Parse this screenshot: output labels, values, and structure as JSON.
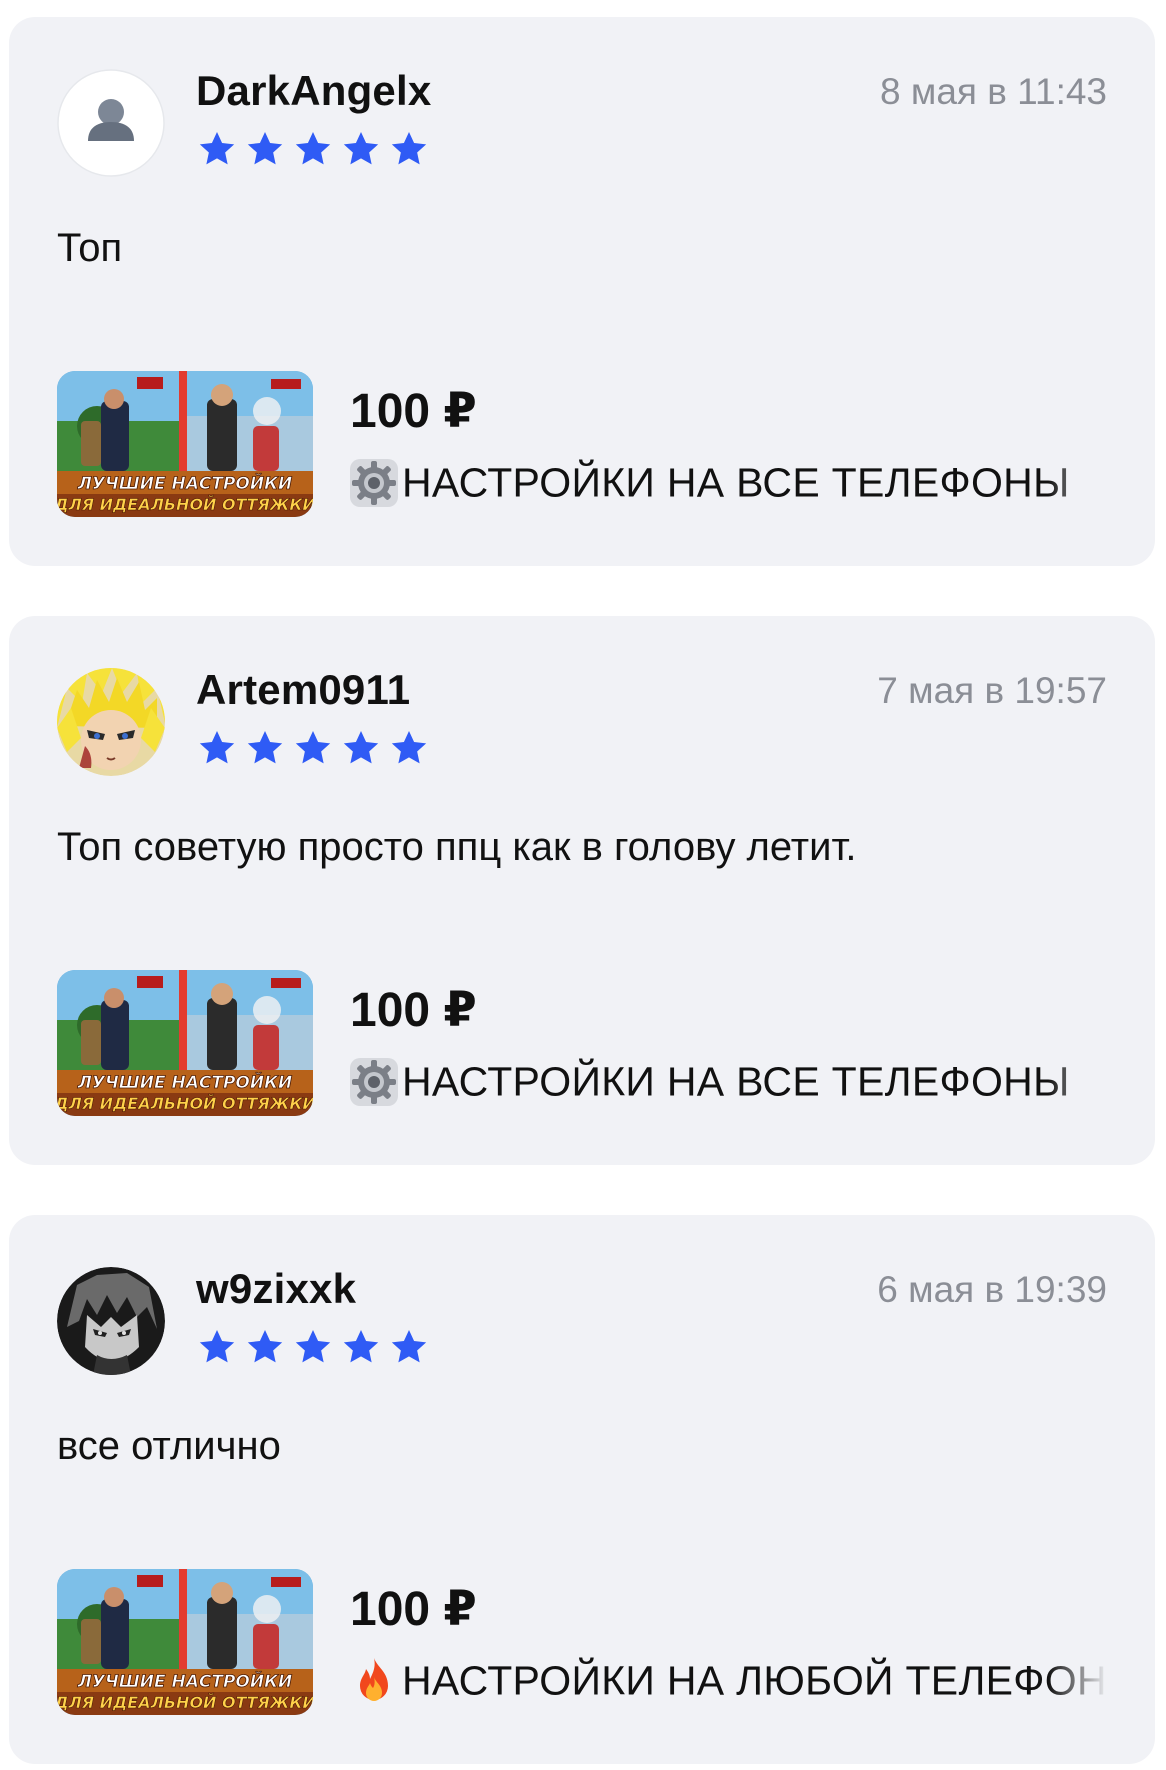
{
  "reviews": [
    {
      "username": "DarkAngelx",
      "date": "8 мая в 11:43",
      "rating": 5,
      "avatar": "default-user-icon",
      "text": "Топ",
      "product": {
        "price": "100 ₽",
        "icon": "gear-icon",
        "title": "НАСТРОЙКИ НА ВСЕ ТЕЛЕФОНЫ",
        "thumbnail_text": [
          "ЛУЧШИЕ НАСТРОЙКИ",
          "ДЛЯ ИДЕАЛЬНОЙ ОТТЯЖКИ"
        ]
      }
    },
    {
      "username": "Artem0911",
      "date": "7 мая в 19:57",
      "rating": 5,
      "avatar": "anime-yellow-hair-avatar",
      "text": "Топ советую просто ппц как в голову летит.",
      "product": {
        "price": "100 ₽",
        "icon": "gear-icon",
        "title": "НАСТРОЙКИ НА ВСЕ ТЕЛЕФОНЫ",
        "thumbnail_text": [
          "ЛУЧШИЕ НАСТРОЙКИ",
          "ДЛЯ ИДЕАЛЬНОЙ ОТТЯЖКИ"
        ]
      }
    },
    {
      "username": "w9zixxk",
      "date": "6 мая в 19:39",
      "rating": 5,
      "avatar": "dark-anime-avatar",
      "text": "все отлично",
      "product": {
        "price": "100 ₽",
        "icon": "fire-icon",
        "title": "НАСТРОЙКИ НА ЛЮБОЙ ТЕЛЕФОН",
        "thumbnail_text": [
          "ЛУЧШИЕ НАСТРОЙКИ",
          "ДЛЯ ИДЕАЛЬНОЙ ОТТЯЖКИ"
        ]
      }
    }
  ],
  "colors": {
    "card_background": "#f1f2f6",
    "star": "#2f5bf5",
    "date": "#8b8e96",
    "text": "#111111"
  }
}
